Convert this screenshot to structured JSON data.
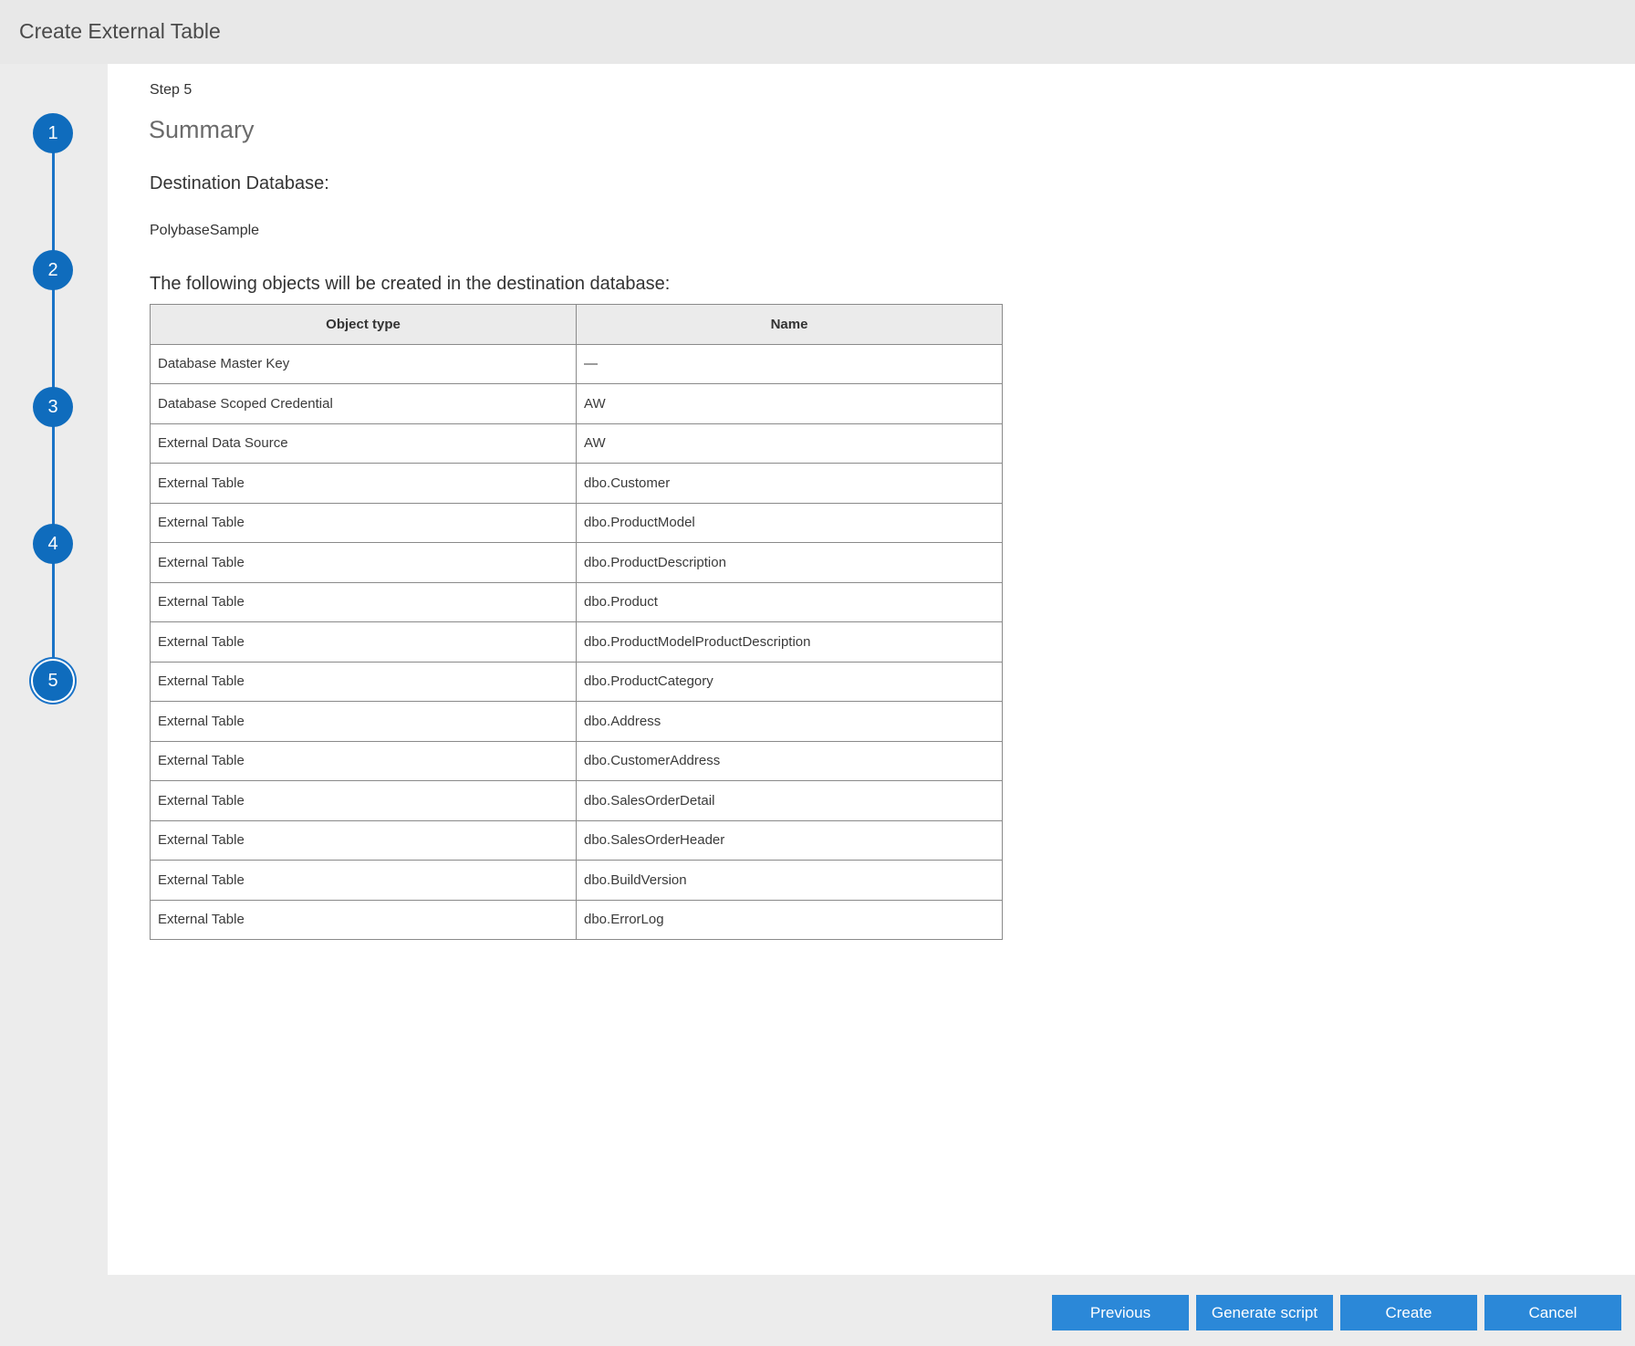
{
  "window": {
    "title": "Create External Table"
  },
  "steps": [
    {
      "number": "1"
    },
    {
      "number": "2"
    },
    {
      "number": "3"
    },
    {
      "number": "4"
    },
    {
      "number": "5",
      "active": true
    }
  ],
  "main": {
    "step_label": "Step 5",
    "title": "Summary",
    "destination_label": "Destination Database:",
    "destination_value": "PolybaseSample",
    "objects_label": "The following objects will be created in the destination database:"
  },
  "table": {
    "headers": [
      "Object type",
      "Name"
    ],
    "rows": [
      [
        "Database Master Key",
        "—"
      ],
      [
        "Database Scoped Credential",
        "AW"
      ],
      [
        "External Data Source",
        "AW"
      ],
      [
        "External Table",
        "dbo.Customer"
      ],
      [
        "External Table",
        "dbo.ProductModel"
      ],
      [
        "External Table",
        "dbo.ProductDescription"
      ],
      [
        "External Table",
        "dbo.Product"
      ],
      [
        "External Table",
        "dbo.ProductModelProductDescription"
      ],
      [
        "External Table",
        "dbo.ProductCategory"
      ],
      [
        "External Table",
        "dbo.Address"
      ],
      [
        "External Table",
        "dbo.CustomerAddress"
      ],
      [
        "External Table",
        "dbo.SalesOrderDetail"
      ],
      [
        "External Table",
        "dbo.SalesOrderHeader"
      ],
      [
        "External Table",
        "dbo.BuildVersion"
      ],
      [
        "External Table",
        "dbo.ErrorLog"
      ]
    ]
  },
  "footer": {
    "previous": "Previous",
    "generate_script": "Generate script",
    "create": "Create",
    "cancel": "Cancel"
  },
  "colors": {
    "accent": "#0f6cbd",
    "button": "#2b88d8",
    "chrome": "#e8e8e8"
  }
}
